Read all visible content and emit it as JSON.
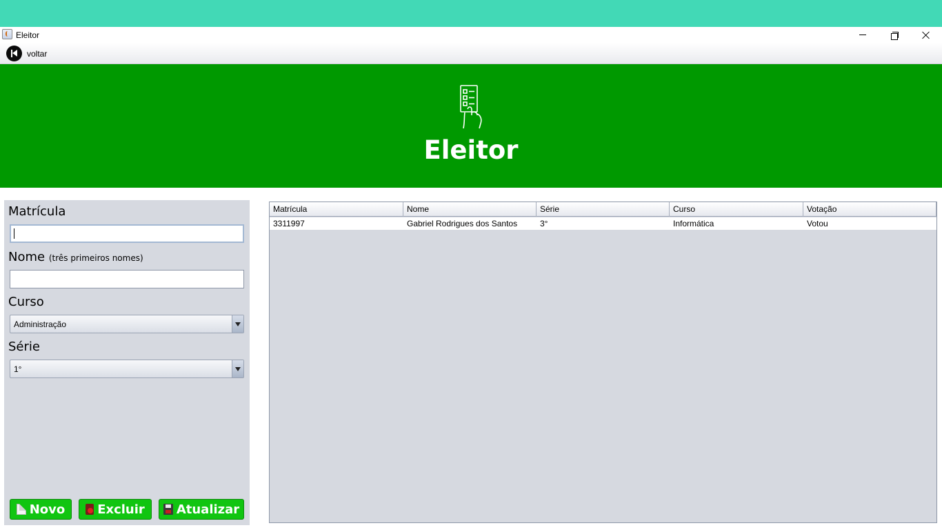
{
  "window": {
    "title": "Eleitor"
  },
  "menu": {
    "back_label": "voltar"
  },
  "banner": {
    "title": "Eleitor"
  },
  "form": {
    "matricula_label": "Matrícula",
    "matricula_value": "",
    "nome_label": "Nome",
    "nome_hint": "(três primeiros nomes)",
    "nome_value": "",
    "curso_label": "Curso",
    "curso_selected": "Administração",
    "serie_label": "Série",
    "serie_selected": "1°"
  },
  "buttons": {
    "novo": "Novo",
    "excluir": "Excluir",
    "atualizar": "Atualizar"
  },
  "table": {
    "columns": [
      "Matrícula",
      "Nome",
      "Série",
      "Curso",
      "Votação"
    ],
    "rows": [
      [
        "3311997",
        "Gabriel Rodrigues dos Santos",
        "3°",
        "Informática",
        "Votou"
      ]
    ]
  },
  "colors": {
    "top_band": "#42d9b6",
    "banner": "#009900",
    "button": "#11c511",
    "panel": "#d6d9e0"
  },
  "icons": [
    "app-icon",
    "minimize-icon",
    "restore-icon",
    "close-icon",
    "back-icon",
    "ballot-icon",
    "dropdown-arrow-icon",
    "new-document-icon",
    "trash-icon",
    "save-icon"
  ]
}
